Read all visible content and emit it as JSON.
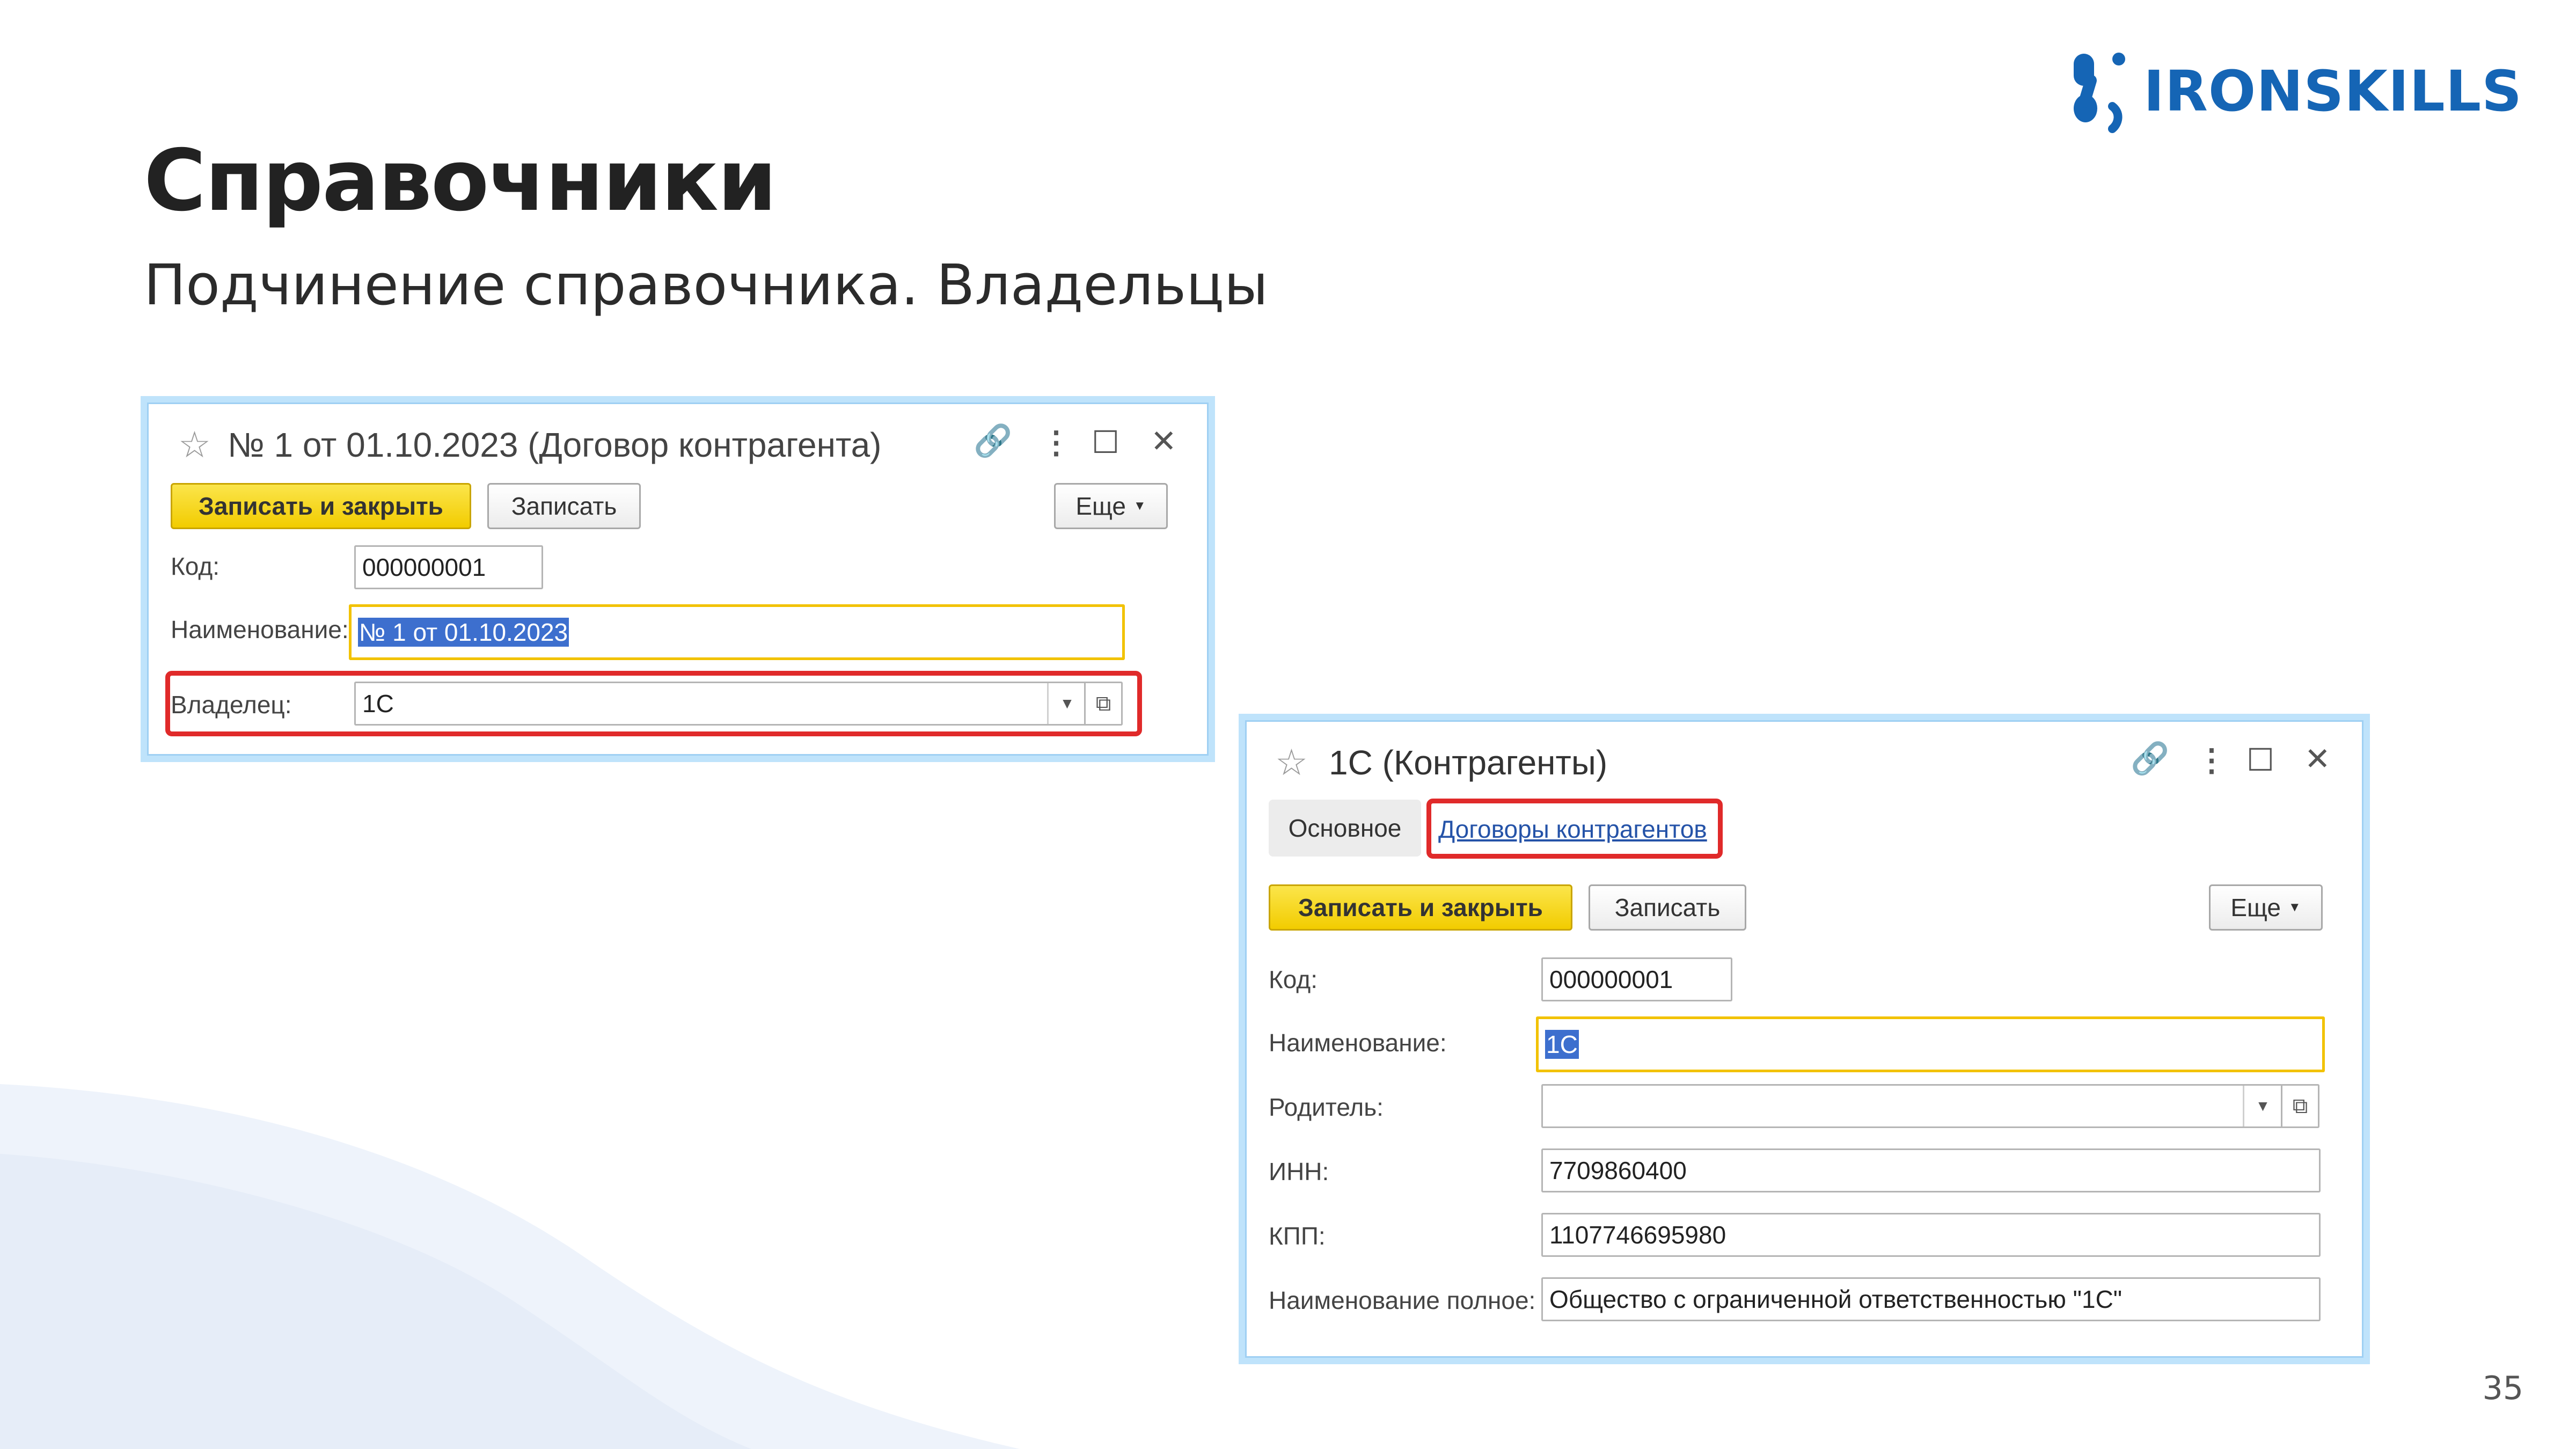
{
  "slide": {
    "title": "Справочники",
    "subtitle": "Подчинение справочника. Владельцы",
    "brand": "IRONSKILLS",
    "page_number": "35",
    "brand_color": "#1565b5",
    "highlight_color": "#e02a2a"
  },
  "contract_window": {
    "title": "№ 1 от 01.10.2023 (Договор контрагента)",
    "buttons": {
      "save_close": "Записать и закрыть",
      "save": "Записать",
      "more": "Еще"
    },
    "fields": {
      "code_label": "Код:",
      "code_value": "000000001",
      "name_label": "Наименование:",
      "name_value": "№ 1 от 01.10.2023",
      "owner_label": "Владелец:",
      "owner_value": "1С"
    }
  },
  "counterparty_window": {
    "title": "1С (Контрагенты)",
    "tabs": {
      "main": "Основное",
      "contracts": "Договоры контрагентов"
    },
    "buttons": {
      "save_close": "Записать и закрыть",
      "save": "Записать",
      "more": "Еще"
    },
    "fields": {
      "code_label": "Код:",
      "code_value": "000000001",
      "name_label": "Наименование:",
      "name_value": "1С",
      "parent_label": "Родитель:",
      "parent_value": "",
      "inn_label": "ИНН:",
      "inn_value": "7709860400",
      "kpp_label": "КПП:",
      "kpp_value": "1107746695980",
      "fullname_label": "Наименование полное:",
      "fullname_value": "Общество с ограниченной ответственностью \"1С\""
    }
  }
}
